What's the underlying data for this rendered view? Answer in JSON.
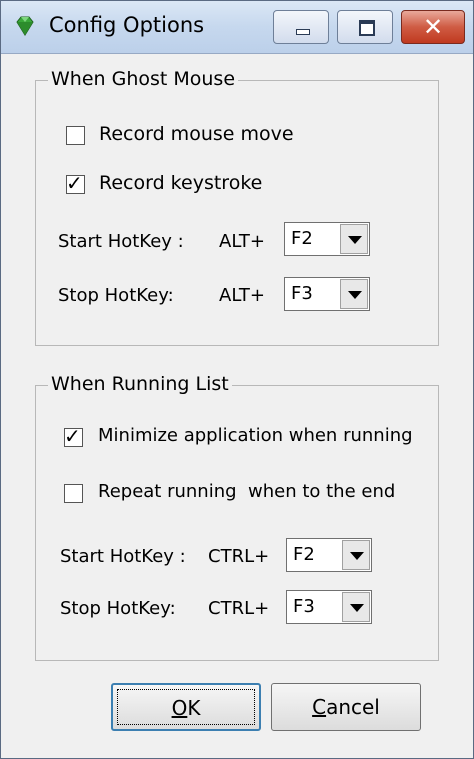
{
  "window": {
    "title": "Config Options",
    "icon": "gem-icon",
    "controls": {
      "minimize": "minimize-icon",
      "maximize": "maximize-icon",
      "close": "✕"
    }
  },
  "ghost_mouse": {
    "legend": "When Ghost Mouse",
    "record_mouse_move": {
      "label": "Record mouse move",
      "checked": false
    },
    "record_keystroke": {
      "label": "Record keystroke",
      "checked": true
    },
    "start_hotkey": {
      "label": "Start HotKey :",
      "modifier": "ALT+",
      "key": "F2"
    },
    "stop_hotkey": {
      "label": "Stop HotKey:",
      "modifier": "ALT+",
      "key": "F3"
    }
  },
  "running_list": {
    "legend": "When Running List",
    "minimize_app": {
      "label": "Minimize application when running",
      "checked": true
    },
    "repeat_running": {
      "label": "Repeat running  when to the end",
      "checked": false
    },
    "start_hotkey": {
      "label": "Start HotKey :",
      "modifier": "CTRL+",
      "key": "F2"
    },
    "stop_hotkey": {
      "label": "Stop HotKey:",
      "modifier": "CTRL+",
      "key": "F3"
    }
  },
  "buttons": {
    "ok_mnemonic": "O",
    "ok_rest": "K",
    "cancel_mnemonic": "C",
    "cancel_rest": "ancel"
  },
  "colors": {
    "title_bar": "#c6d8ee",
    "close_button": "#c0391f",
    "dialog_bg": "#f0f0f0",
    "default_button_border": "#3c7fb1"
  }
}
